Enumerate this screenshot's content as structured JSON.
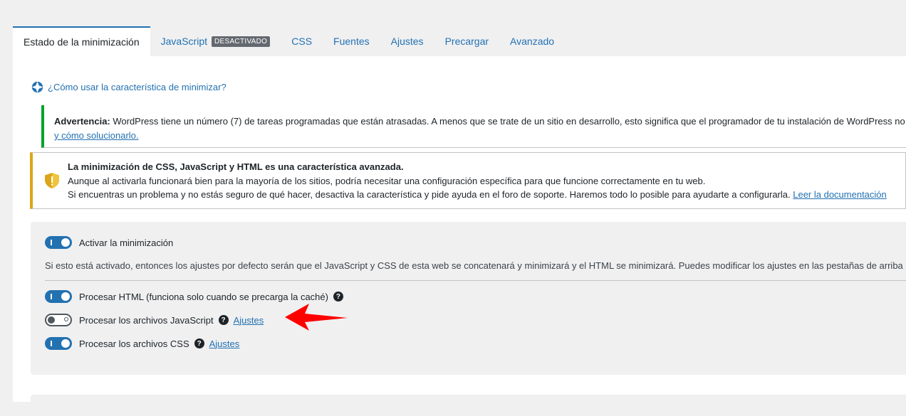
{
  "tabs": [
    {
      "label": "Estado de la minimización",
      "active": true
    },
    {
      "label": "JavaScript",
      "badge": "DESACTIVADO"
    },
    {
      "label": "CSS"
    },
    {
      "label": "Fuentes"
    },
    {
      "label": "Ajustes"
    },
    {
      "label": "Precargar"
    },
    {
      "label": "Avanzado"
    }
  ],
  "help_link": "¿Cómo usar la característica de minimizar?",
  "warning_notice": {
    "strong": "Advertencia:",
    "text": " WordPress tiene un número (7) de tareas programadas que están atrasadas. A menos que se trate de un sitio en desarrollo, esto significa que el programador de tu instalación de WordPress no fun",
    "link": "y cómo solucionarlo."
  },
  "advanced_notice": {
    "title": "La minimización de CSS, JavaScript y HTML es una característica avanzada.",
    "line1": "Aunque al activarla funcionará bien para la mayoría de los sitios, podría necesitar una configuración específica para que funcione correctamente en tu web.",
    "line2": "Si encuentras un problema y no estás seguro de qué hacer, desactiva la característica y pide ayuda en el foro de soporte. Haremos todo lo posible para ayudarte a configurarla.",
    "link": "Leer la documentación"
  },
  "settings": {
    "enable_label": "Activar la minimización",
    "enable_on": true,
    "description": "Si esto está activado, entonces los ajustes por defecto serán que el JavaScript y CSS de esta web se concatenará y minimizará y el HTML se minimizará. Puedes modificar los ajustes en las pestañas de arriba para c",
    "html_label": "Procesar HTML (funciona solo cuando se precarga la caché)",
    "html_on": true,
    "js_label": "Procesar los archivos JavaScript",
    "js_on": false,
    "js_link": "Ajustes",
    "css_label": "Procesar los archivos CSS",
    "css_on": true,
    "css_link": "Ajustes",
    "help_mark": "?"
  },
  "colors": {
    "accent": "#2271b1",
    "success_border": "#00a32a",
    "warning_border": "#dba617",
    "annotation_arrow": "#ff0000"
  }
}
